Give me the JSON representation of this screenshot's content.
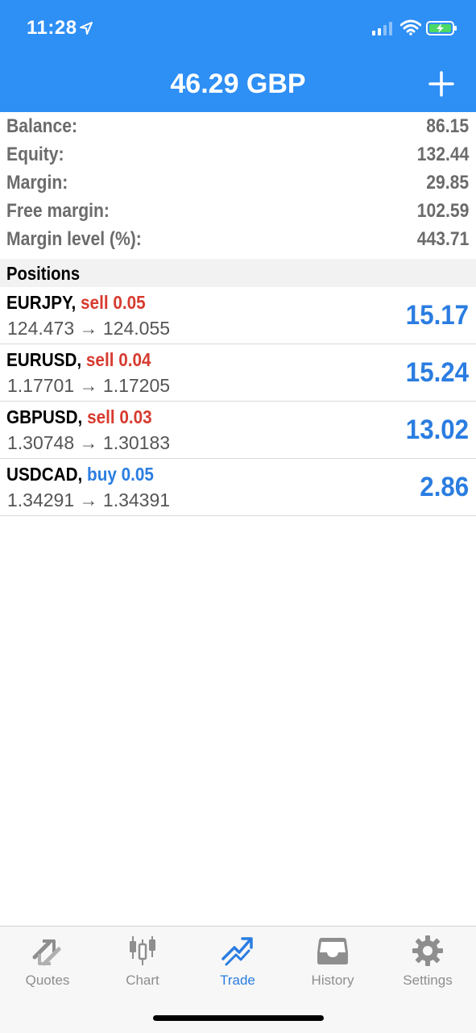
{
  "status_bar": {
    "time": "11:28"
  },
  "header": {
    "title": "46.29 GBP"
  },
  "summary": [
    {
      "label": "Balance:",
      "value": "86.15"
    },
    {
      "label": "Equity:",
      "value": "132.44"
    },
    {
      "label": "Margin:",
      "value": "29.85"
    },
    {
      "label": "Free margin:",
      "value": "102.59"
    },
    {
      "label": "Margin level (%):",
      "value": "443.71"
    }
  ],
  "positions_header": "Positions",
  "positions": [
    {
      "symbol": "EURJPY,",
      "side": "sell 0.05",
      "side_type": "sell",
      "prices": "124.473 → 124.055",
      "profit": "15.17"
    },
    {
      "symbol": "EURUSD,",
      "side": "sell 0.04",
      "side_type": "sell",
      "prices": "1.17701 → 1.17205",
      "profit": "15.24"
    },
    {
      "symbol": "GBPUSD,",
      "side": "sell 0.03",
      "side_type": "sell",
      "prices": "1.30748 → 1.30183",
      "profit": "13.02"
    },
    {
      "symbol": "USDCAD,",
      "side": "buy 0.05",
      "side_type": "buy",
      "prices": "1.34291 → 1.34391",
      "profit": "2.86"
    }
  ],
  "tabs": [
    {
      "label": "Quotes",
      "icon": "quotes-icon",
      "active": false
    },
    {
      "label": "Chart",
      "icon": "candlestick-chart-icon",
      "active": false
    },
    {
      "label": "Trade",
      "icon": "trade-trend-icon",
      "active": true
    },
    {
      "label": "History",
      "icon": "inbox-icon",
      "active": false
    },
    {
      "label": "Settings",
      "icon": "gear-icon",
      "active": false
    }
  ],
  "colors": {
    "header_blue": "#2e8ff5",
    "sell_red": "#d73b2f",
    "buy_blue": "#2a7de1",
    "tab_inactive": "#8e8e8e"
  }
}
